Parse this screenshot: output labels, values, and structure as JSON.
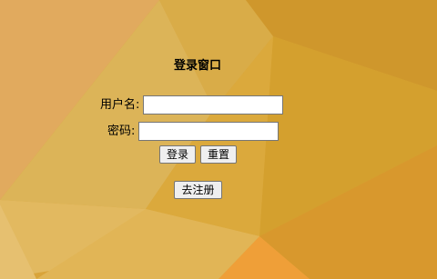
{
  "login": {
    "title": "登录窗口",
    "username_label": "用户名:",
    "username_value": "",
    "password_label": "密码:",
    "password_value": "",
    "login_button": "登录",
    "reset_button": "重置",
    "register_button": "去注册"
  },
  "colors": {
    "background_base": "#d9a43a",
    "facet_light": "#e2b45a",
    "facet_mid": "#d39c2e",
    "facet_dark": "#c98d28",
    "facet_orange": "#e89a35"
  }
}
